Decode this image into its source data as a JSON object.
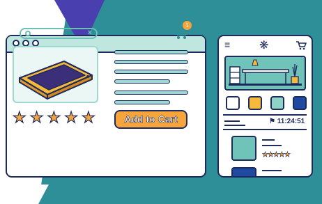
{
  "colors": {
    "navy": "#1f2a5c",
    "teal": "#6fc3b8",
    "teal_dark": "#2f8f98",
    "orange": "#f5a53b",
    "purple": "#4a3fae"
  },
  "desktop": {
    "window_dots": [
      "close-dot",
      "minimize-dot",
      "maximize-dot"
    ],
    "search": {
      "placeholder": "",
      "clear_icon": "×"
    },
    "cart": {
      "badge": "1"
    },
    "rating": {
      "stars": "★★★★★",
      "value": 5
    },
    "add_to_cart_label": "Add to Cart"
  },
  "mobile": {
    "menu_icon": "≡",
    "logo_icon": "❋",
    "swatches": [
      "#ffffff",
      "#f5b93b",
      "#8fd3c6",
      "#1f4aa0"
    ],
    "timer": "11:24:51",
    "mini_stars": "★★★★★"
  }
}
